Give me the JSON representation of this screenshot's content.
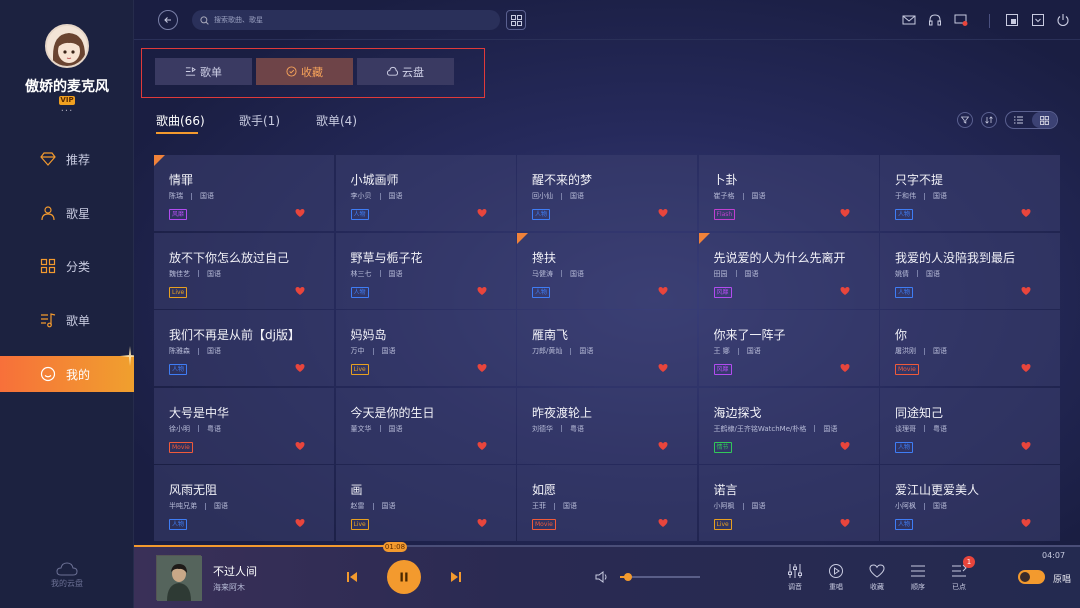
{
  "user": {
    "name": "傲娇的麦克风",
    "vip": "VIP",
    "more": "···"
  },
  "nav": [
    {
      "label": "推荐",
      "icon": "diamond-icon"
    },
    {
      "label": "歌星",
      "icon": "person-icon"
    },
    {
      "label": "分类",
      "icon": "grid-icon"
    },
    {
      "label": "歌单",
      "icon": "music-list-icon"
    },
    {
      "label": "我的",
      "icon": "face-icon",
      "active": true
    }
  ],
  "cloud": {
    "label": "我的云盘"
  },
  "search": {
    "placeholder": "搜索歌曲、歌星"
  },
  "segments": [
    {
      "label": "歌单"
    },
    {
      "label": "收藏",
      "active": true
    },
    {
      "label": "云盘"
    }
  ],
  "subtabs": [
    {
      "label": "歌曲(66)",
      "active": true
    },
    {
      "label": "歌手(1)"
    },
    {
      "label": "歌单(4)"
    }
  ],
  "colors": {
    "accent": "#f39a2e",
    "heart": "#e8453c"
  },
  "tag_colors": {
    "风靡": "#b24cf0",
    "人物": "#3f7df5",
    "Flash": "#c040d0",
    "Live": "#e8a020",
    "Movie": "#f05a3a",
    "情节": "#32c85a"
  },
  "songs": [
    {
      "title": "情罪",
      "artist": "陈瑞",
      "lang": "国语",
      "tag": "风靡",
      "corner": true
    },
    {
      "title": "小城画师",
      "artist": "李小贝",
      "lang": "国语",
      "tag": "人物"
    },
    {
      "title": "醒不来的梦",
      "artist": "回小仙",
      "lang": "国语",
      "tag": "人物"
    },
    {
      "title": "卜卦",
      "artist": "崔子格",
      "lang": "国语",
      "tag": "Flash"
    },
    {
      "title": "只字不提",
      "artist": "于和伟",
      "lang": "国语",
      "tag": "人物"
    },
    {
      "title": "放不下你怎么放过自己",
      "artist": "魏佳艺",
      "lang": "国语",
      "tag": "Live"
    },
    {
      "title": "野草与栀子花",
      "artist": "林三七",
      "lang": "国语",
      "tag": "人物"
    },
    {
      "title": "搀扶",
      "artist": "马健涛",
      "lang": "国语",
      "tag": "人物",
      "corner": true
    },
    {
      "title": "先说爱的人为什么先离开",
      "artist": "田园",
      "lang": "国语",
      "tag": "风靡",
      "corner": true
    },
    {
      "title": "我爱的人没陪我到最后",
      "artist": "姚倩",
      "lang": "国语",
      "tag": "人物"
    },
    {
      "title": "我们不再是从前【dj版】",
      "artist": "陈雅森",
      "lang": "国语",
      "tag": "人物"
    },
    {
      "title": "妈妈岛",
      "artist": "万中",
      "lang": "国语",
      "tag": "Live"
    },
    {
      "title": "雁南飞",
      "artist": "刀郎/黄灿",
      "lang": "国语",
      "tag": ""
    },
    {
      "title": "你来了一阵子",
      "artist": "王 娜",
      "lang": "国语",
      "tag": "风靡"
    },
    {
      "title": "你",
      "artist": "屠洪刚",
      "lang": "国语",
      "tag": "Movie"
    },
    {
      "title": "大号是中华",
      "artist": "徐小明",
      "lang": "粤语",
      "tag": "Movie"
    },
    {
      "title": "今天是你的生日",
      "artist": "董文华",
      "lang": "国语",
      "tag": ""
    },
    {
      "title": "昨夜渡轮上",
      "artist": "刘德华",
      "lang": "粤语",
      "tag": ""
    },
    {
      "title": "海边探戈",
      "artist": "王鹤棣/王齐铭WatchMe/朴格",
      "lang": "国语",
      "tag": "情节"
    },
    {
      "title": "同途知己",
      "artist": "谈理哥",
      "lang": "粤语",
      "tag": "人物"
    },
    {
      "title": "风雨无阻",
      "artist": "半吨兄弟",
      "lang": "国语",
      "tag": "人物"
    },
    {
      "title": "画",
      "artist": "赵雷",
      "lang": "国语",
      "tag": "Live"
    },
    {
      "title": "如愿",
      "artist": "王菲",
      "lang": "国语",
      "tag": "Movie"
    },
    {
      "title": "诺言",
      "artist": "小阿枫",
      "lang": "国语",
      "tag": "Live"
    },
    {
      "title": "爱江山更爱美人",
      "artist": "小阿枫",
      "lang": "国语",
      "tag": "人物"
    }
  ],
  "player": {
    "title": "不过人间",
    "artist": "海来阿木",
    "current_time": "01:08",
    "total_time": "04:07",
    "progress_fraction": 0.278,
    "volume_fraction": 0.1,
    "controls": [
      {
        "label": "调音",
        "icon": "equalizer-icon"
      },
      {
        "label": "重唱",
        "icon": "replay-icon"
      },
      {
        "label": "收藏",
        "icon": "heart-outline-icon"
      },
      {
        "label": "顺序",
        "icon": "order-list-icon"
      },
      {
        "label": "已点",
        "icon": "queue-icon"
      }
    ],
    "queue_badge": "1",
    "original_label": "原唱"
  }
}
